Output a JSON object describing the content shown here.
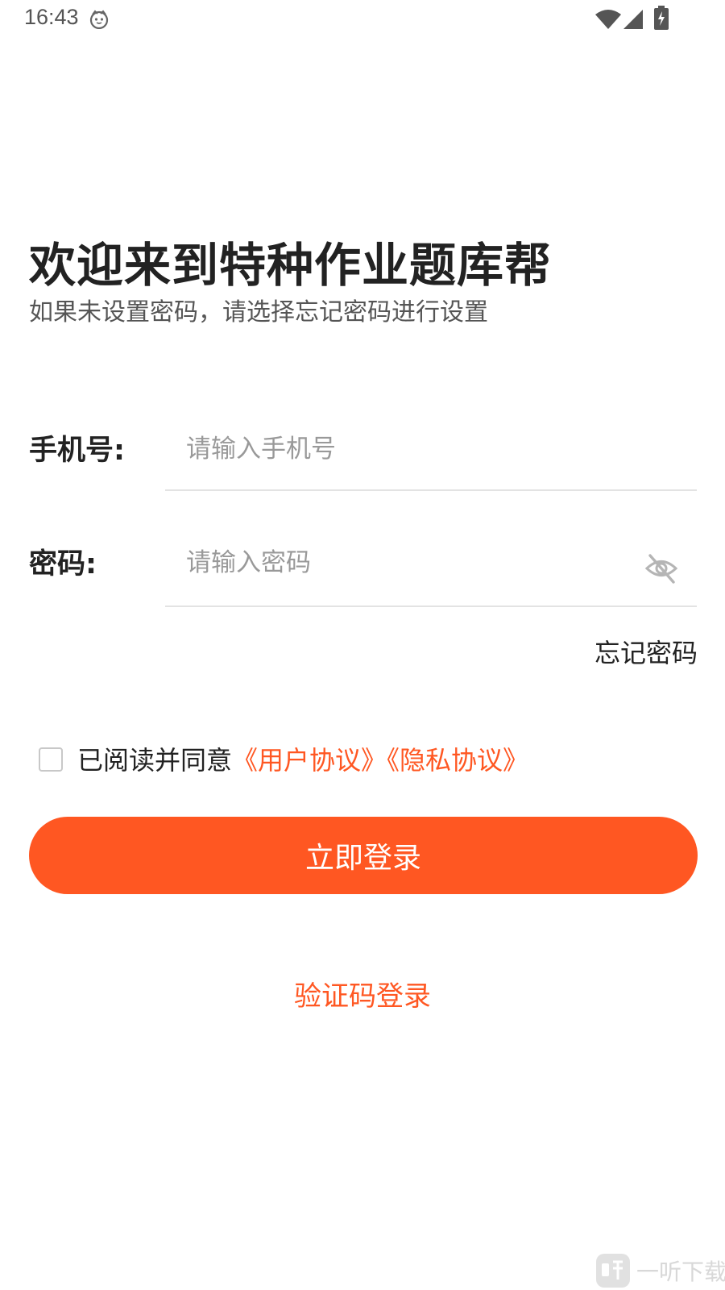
{
  "status_bar": {
    "time": "16:43"
  },
  "header": {
    "title": "欢迎来到特种作业题库帮",
    "subtitle": "如果未设置密码，请选择忘记密码进行设置"
  },
  "form": {
    "phone": {
      "label": "手机号:",
      "placeholder": "请输入手机号",
      "value": ""
    },
    "password": {
      "label": "密码:",
      "placeholder": "请输入密码",
      "value": ""
    },
    "forgot_password": "忘记密码"
  },
  "agreement": {
    "checked": false,
    "prefix": "已阅读并同意",
    "user_agreement": "《用户协议》",
    "privacy_agreement": "《隐私协议》"
  },
  "actions": {
    "login_label": "立即登录",
    "sms_login_label": "验证码登录"
  },
  "watermark": {
    "text": "一听下载"
  },
  "colors": {
    "accent": "#ff5722",
    "text": "#222222",
    "subtext": "#555555",
    "placeholder": "#999999",
    "divider": "#e3e3e3"
  },
  "icons": {
    "status": [
      "cat-face-icon",
      "wifi-icon",
      "signal-icon",
      "battery-charging-icon"
    ],
    "password_toggle": "eye-off-icon",
    "watermark": "listen-logo-icon"
  }
}
